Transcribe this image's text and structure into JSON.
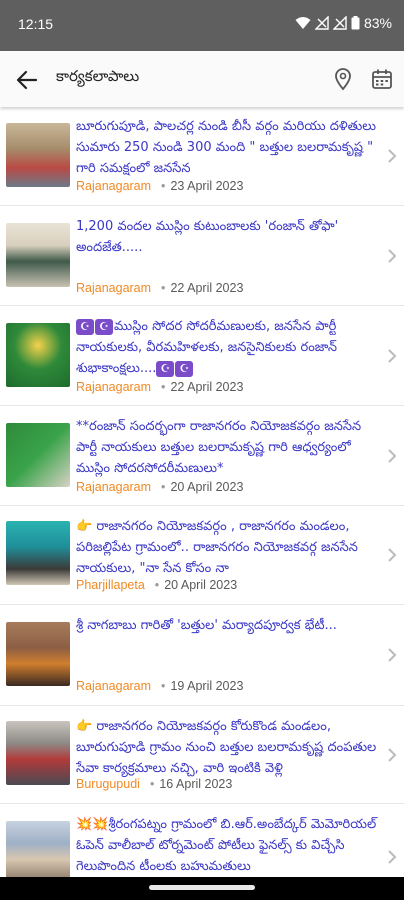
{
  "status_bar": {
    "time": "12:15",
    "battery": "83%"
  },
  "app_bar": {
    "title": "కార్యకలాపాలు",
    "icons": [
      "back-arrow-icon",
      "location-pin-icon",
      "calendar-icon"
    ]
  },
  "items": [
    {
      "title": "బూరుగుపూడి, పాలచర్ల నుండి బీసీ వర్గం మరియు దళితులు సుమారు 250 నుండి 300 మంది \" బత్తుల బలరామకృష్ణ \" గారి సమక్షంలో జనసేన",
      "place": "Rajanagaram",
      "date": "23 April 2023"
    },
    {
      "title": "1,200 వందల ముస్లిం కుటుంబాలకు 'రంజాన్ తోఫా' అందజేత.....",
      "place": "Rajanagaram",
      "date": "22 April 2023"
    },
    {
      "title": "ముస్లిం సోదర సోదరీమణులకు, జనసేన పార్టీ నాయకులకు, వీరమహిళలకు, జనసైనికులకు రంజాన్ శుభాకాంక్షలు....",
      "place": "Rajanagaram",
      "date": "22 April 2023"
    },
    {
      "title": "**రంజాన్ సందర్భంగా రాజానగరం నియోజకవర్గం జనసేన పార్టీ నాయకులు బత్తుల బలరామకృష్ణ గారి ఆధ్వర్యంలో ముస్లిం సోదరసోదరీమణులు*",
      "place": "Rajanagaram",
      "date": "20 April 2023"
    },
    {
      "title": "👉 రాజానగరం నియోజకవర్గం , రాజానగరం మండలం, పరిజల్లిపేట గ్రామంలో.. రాజానగరం నియోజకవర్గ జనసేన నాయకులు, \"నా సేన కోసం నా",
      "place": "Pharjillapeta",
      "date": "20 April 2023"
    },
    {
      "title": "శ్రీ నాగబాబు గారితో 'బత్తుల' మర్యాదపూర్వక భేటీ...",
      "place": "Rajanagaram",
      "date": "19 April 2023"
    },
    {
      "title": "👉 రాజానగరం నియోజకవర్గం కోరుకొండ మండలం, బూరుగుపూడి గ్రామం నుంచి బత్తుల బలరామకృష్ణ దంపతుల సేవా కార్యక్రమాలు నచ్చి, వారి ఇంటికి వెళ్లి",
      "place": "Burugupudi",
      "date": "16 April 2023"
    },
    {
      "title": "💥💥శ్రీరంగపట్నం గ్రామంలో బి.ఆర్.అంబేద్కర్ మెమోరియల్ ఓపెన్ వాలీబాల్ టోర్నమెంట్ పోటీలు ఫైనల్స్ కు విచ్చేసి గెలుపొందిన టీంలకు బహుమతులు",
      "place": "",
      "date": ""
    }
  ],
  "colors": {
    "link": "#3a37c6",
    "accent": "#f08a24",
    "statusbar": "#5f5f5f"
  }
}
